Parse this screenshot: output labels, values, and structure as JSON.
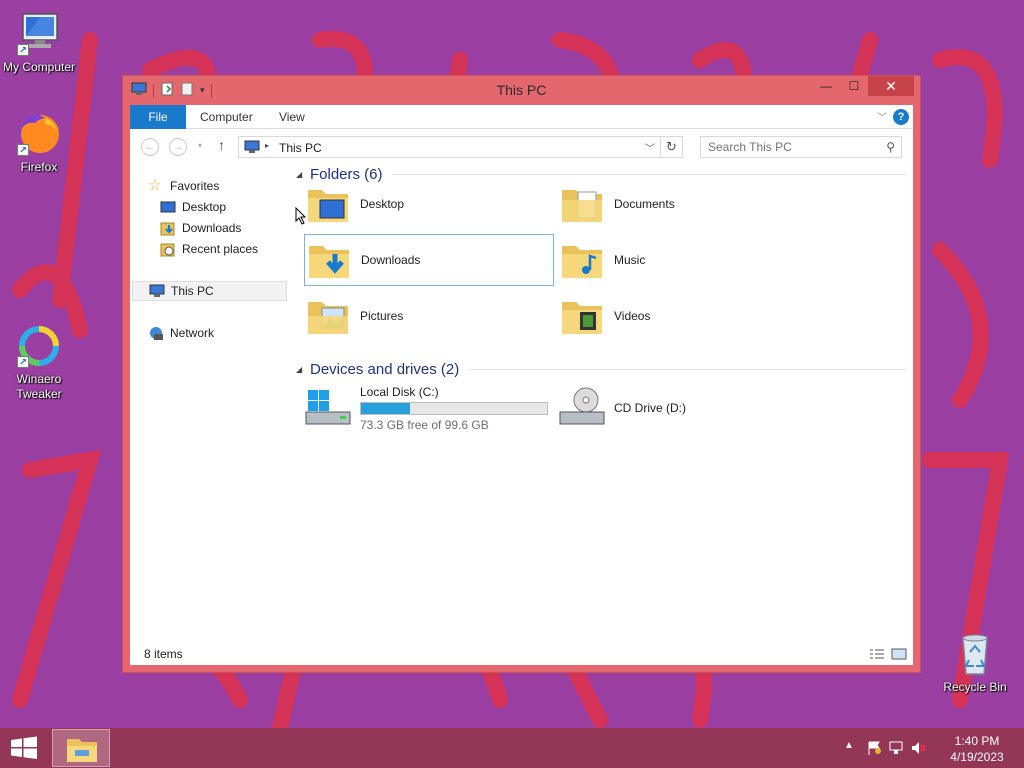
{
  "desktop": {
    "icons": [
      {
        "label": "My Computer",
        "icon": "computer-icon"
      },
      {
        "label": "Firefox",
        "icon": "firefox-icon"
      },
      {
        "label": "Winaero Tweaker",
        "icon": "winaero-icon"
      },
      {
        "label": "Recycle Bin",
        "icon": "recycle-bin-icon"
      }
    ]
  },
  "window": {
    "title": "This PC",
    "close_glyph": "✕",
    "minimize_glyph": "—",
    "maximize_glyph": "☐",
    "ribbon": {
      "tabs": [
        "File",
        "Computer",
        "View"
      ],
      "help_glyph": "?"
    },
    "address": {
      "path": "This PC",
      "search_placeholder": "Search This PC"
    },
    "nav_pane": {
      "favorites_label": "Favorites",
      "favorites": [
        "Desktop",
        "Downloads",
        "Recent places"
      ],
      "this_pc_label": "This PC",
      "network_label": "Network"
    },
    "folders_group": {
      "title": "Folders (6)",
      "items": [
        "Desktop",
        "Documents",
        "Downloads",
        "Music",
        "Pictures",
        "Videos"
      ],
      "selected": "Downloads"
    },
    "drives_group": {
      "title": "Devices and drives (2)",
      "local_disk": {
        "name": "Local Disk (C:)",
        "free_text": "73.3 GB free of 99.6 GB",
        "used_fraction": 0.264
      },
      "cd_drive": {
        "name": "CD Drive (D:)"
      }
    },
    "status": {
      "item_count": "8 items"
    }
  },
  "taskbar": {
    "time": "1:40 PM",
    "date": "4/19/2023"
  },
  "colors": {
    "accent": "#1979ca",
    "window_frame": "#e4676e",
    "taskbar": "#943656",
    "desktop": "#9b3fa3",
    "progress": "#26a0da"
  }
}
